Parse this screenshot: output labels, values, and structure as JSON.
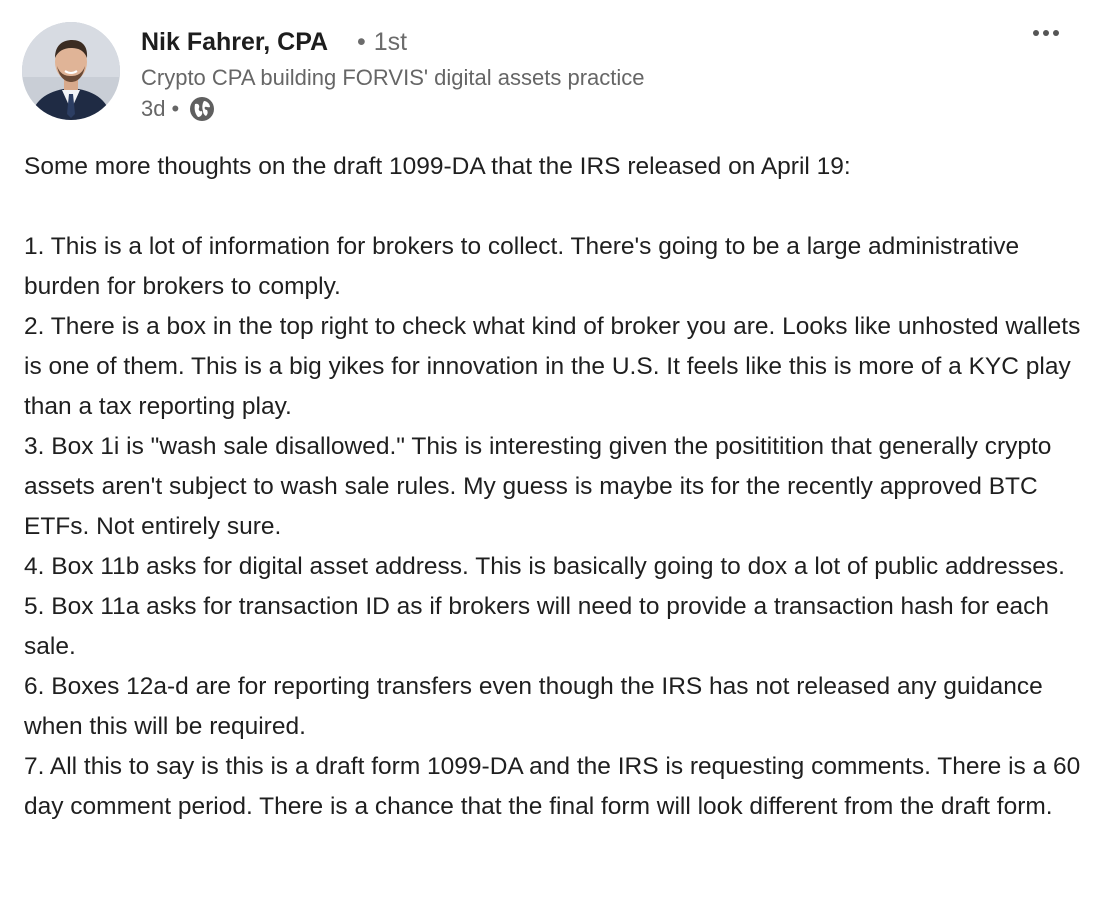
{
  "author": {
    "name": "Nik Fahrer, CPA",
    "degree": "1st",
    "headline": "Crypto CPA building FORVIS' digital assets practice",
    "posted_ago": "3d",
    "visibility_icon": "globe-icon"
  },
  "menu": {
    "icon": "more-horizontal-icon"
  },
  "post": {
    "intro": "Some more thoughts on the draft 1099-DA that the IRS released on April 19:",
    "points": [
      "1. This is a lot of information for brokers to collect. There's going to be a large administrative burden for brokers to comply.",
      "2. There is a box in the top right to check what kind of broker you are. Looks like unhosted wallets is one of them. This is a big yikes for innovation in the U.S. It feels like this is more of a KYC play than a tax reporting play.",
      "3. Box 1i is \"wash sale disallowed.\" This is interesting given the posititition that generally crypto assets aren't subject to wash sale rules. My guess is maybe its for the recently approved BTC ETFs. Not entirely sure.",
      "4. Box 11b asks for digital asset address. This is basically going to dox a lot of public addresses.",
      "5. Box 11a asks for transaction ID as if brokers will need to provide a transaction hash for each sale.",
      "6. Boxes 12a-d are for reporting transfers even though the IRS has not released any guidance when this will be required.",
      "7. All this to say is this is a draft form 1099-DA and the IRS is requesting comments. There is a 60 day comment period. There is a chance that the final form will look different from the draft form."
    ]
  },
  "colors": {
    "name": "#1d1d1d",
    "secondary_text": "#666666",
    "body_text": "#1f1f1f"
  }
}
